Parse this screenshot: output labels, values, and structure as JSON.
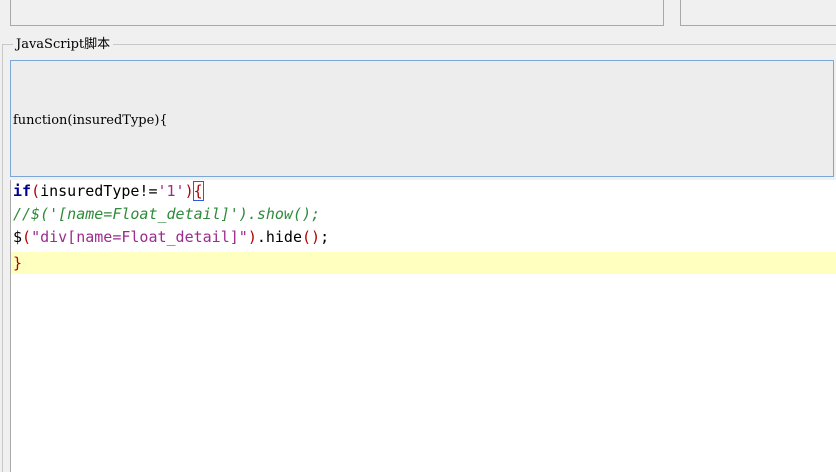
{
  "group": {
    "label": "JavaScript脚本"
  },
  "signature": {
    "text": "function(insuredType){"
  },
  "editor": {
    "lines": [
      [
        {
          "cls": "kw",
          "t": "if"
        },
        {
          "cls": "paren",
          "t": "("
        },
        {
          "cls": "plain",
          "t": "insuredType!="
        },
        {
          "cls": "str",
          "t": "'1'"
        },
        {
          "cls": "paren",
          "t": ")"
        },
        {
          "cls": "brace-match",
          "t": "{"
        }
      ],
      [
        {
          "cls": "cmt",
          "t": "//$('[name=Float_detail]').show();"
        }
      ],
      [
        {
          "cls": "plain",
          "t": "$"
        },
        {
          "cls": "paren",
          "t": "("
        },
        {
          "cls": "str",
          "t": "\"div[name=Float_detail]\""
        },
        {
          "cls": "paren",
          "t": ")"
        },
        {
          "cls": "plain",
          "t": ".hide"
        },
        {
          "cls": "paren",
          "t": "()"
        },
        {
          "cls": "plain",
          "t": ";"
        }
      ],
      [
        {
          "cls": "paren",
          "t": "}"
        }
      ]
    ],
    "highlighted_line": 4
  },
  "colors": {
    "line_highlight": "#ffffbf",
    "keyword": "#00008b",
    "string": "#9d2b8e",
    "comment": "#2e8b3a",
    "paren": "#b00000",
    "focus_border": "#7aa7d8"
  }
}
